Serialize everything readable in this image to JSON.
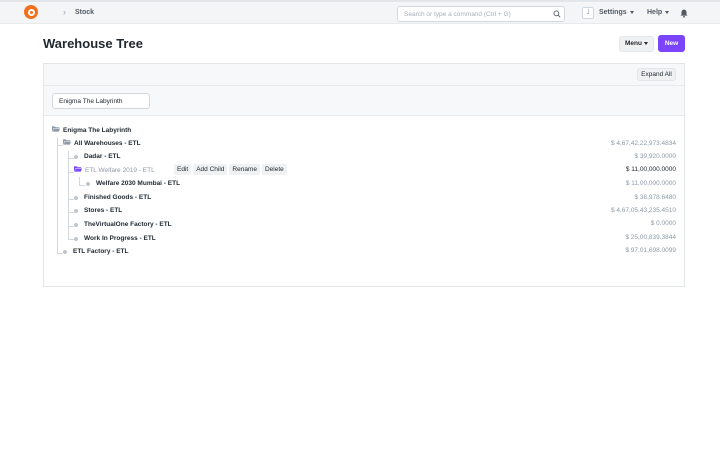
{
  "navbar": {
    "breadcrumb": "Stock",
    "search_placeholder": "Search or type a command (Ctrl + G)",
    "avatar_letter": "J",
    "settings_label": "Settings",
    "help_label": "Help"
  },
  "page": {
    "title": "Warehouse Tree",
    "menu_label": "Menu",
    "new_label": "New"
  },
  "toolbar": {
    "expand_all_label": "Expand All"
  },
  "filter": {
    "company_value": "Enigma The Labyrinth"
  },
  "tree": {
    "root": {
      "label": "Enigma The Labyrinth"
    },
    "nodes": [
      {
        "label": "All Warehouses - ETL",
        "balance": "$ 4,67,42,22,973.4834"
      },
      {
        "label": "Dadar - ETL",
        "balance": "$ 39,920.0000"
      },
      {
        "label": "ETL Welfare 2019 - ETL",
        "balance": "$ 11,00,000.0000"
      },
      {
        "label": "Welfare 2030 Mumbai - ETL",
        "balance": "$ 11,00,000.0000"
      },
      {
        "label": "Finished Goods - ETL",
        "balance": "$ 38,978.6480"
      },
      {
        "label": "Stores - ETL",
        "balance": "$ 4,67,05,43,235.4510"
      },
      {
        "label": "TheVirtualOne Factory - ETL",
        "balance": "$ 0.0000"
      },
      {
        "label": "Work In Progress - ETL",
        "balance": "$ 25,00,839.3844"
      },
      {
        "label": "ETL Factory - ETL",
        "balance": "$ 97,01,698.0099"
      }
    ],
    "actions": {
      "edit": "Edit",
      "add_child": "Add Child",
      "rename": "Rename",
      "delete": "Delete"
    }
  },
  "colors": {
    "accent": "#7b45ff",
    "logo": "#f3711e",
    "folder": "#8d99a6",
    "folder_selected": "#7b45ff"
  }
}
